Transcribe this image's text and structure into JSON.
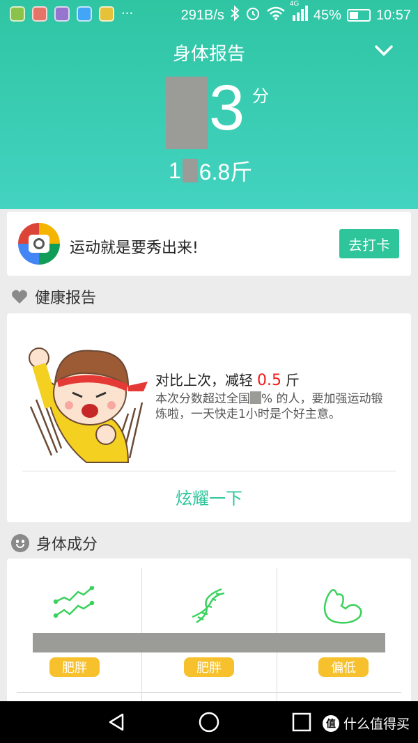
{
  "status_bar": {
    "network_speed": "291B/s",
    "network_type": "4G",
    "battery": "45%",
    "battery_level": 0.45,
    "time": "10:57",
    "icons": [
      "app-icon",
      "app-icon",
      "app-icon",
      "app-icon",
      "app-icon",
      "more-icon",
      "bluetooth-icon",
      "alarm-icon",
      "wifi-icon",
      "signal-icon",
      "battery-icon"
    ]
  },
  "header": {
    "title": "身体报告",
    "score_digit": "3",
    "score_unit": "分",
    "weight_prefix": "1",
    "weight_suffix": "6.8斤"
  },
  "promo": {
    "text": "运动就是要秀出来!",
    "button_label": "去打卡"
  },
  "health_report": {
    "section_title": "健康报告",
    "compare_prefix": "对比上次，减轻",
    "compare_value": "0.5",
    "compare_unit": "斤",
    "desc_part1": "本次分数超过全国",
    "desc_part2": "% 的人，要加强运动锻炼啦，一天快走1小时是个好主意。",
    "share_label": "炫耀一下"
  },
  "body_composition": {
    "section_title": "身体成分",
    "items": [
      {
        "icon": "trend-chart-icon",
        "badge": "肥胖"
      },
      {
        "icon": "dna-icon",
        "badge": "肥胖"
      },
      {
        "icon": "muscle-icon",
        "badge": "偏低"
      }
    ]
  },
  "navbar": {
    "watermark": "什么值得买",
    "watermark_logo": "值"
  },
  "colors": {
    "header_start": "#2fc5a3",
    "header_end": "#43d3c1",
    "accent": "#2ec59a",
    "highlight_red": "#f01b1b",
    "badge": "#f6c12c"
  }
}
